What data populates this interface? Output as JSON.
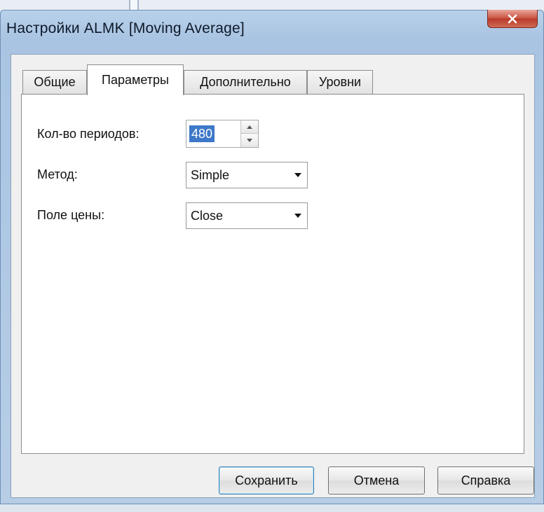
{
  "window": {
    "title": "Настройки ALMK [Moving Average]",
    "close_glyph": "x"
  },
  "tabs": [
    {
      "label": "Общие",
      "active": false
    },
    {
      "label": "Параметры",
      "active": true
    },
    {
      "label": "Дополнительно",
      "active": false
    },
    {
      "label": "Уровни",
      "active": false
    }
  ],
  "params": {
    "period_label": "Кол-во периодов:",
    "period_value": "480",
    "method_label": "Метод:",
    "method_value": "Simple",
    "price_label": "Поле цены:",
    "price_value": "Close"
  },
  "buttons": {
    "save": "Сохранить",
    "cancel": "Отмена",
    "help": "Справка"
  },
  "colors": {
    "selection": "#3d78c9",
    "close_button": "#c9513e",
    "frame": "#b9d1ea"
  }
}
